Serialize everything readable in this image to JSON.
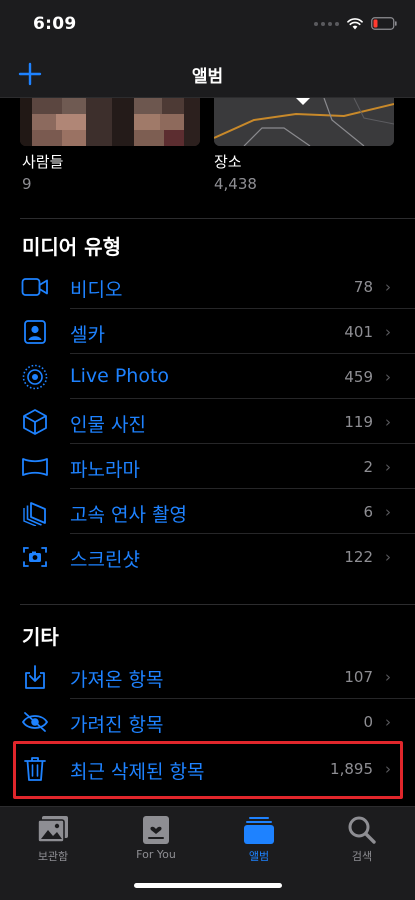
{
  "status_bar": {
    "time": "6:09"
  },
  "nav": {
    "title": "앨범",
    "add_icon": "plus-icon"
  },
  "people": {
    "caption": "사람들",
    "count": "9"
  },
  "places": {
    "caption": "장소",
    "count": "4,438"
  },
  "media_types": {
    "title": "미디어 유형",
    "items": [
      {
        "label": "비디오",
        "count": "78",
        "icon": "video-icon"
      },
      {
        "label": "셀카",
        "count": "401",
        "icon": "selfie-icon"
      },
      {
        "label": "Live Photo",
        "count": "459",
        "icon": "live-photo-icon"
      },
      {
        "label": "인물 사진",
        "count": "119",
        "icon": "portrait-cube-icon"
      },
      {
        "label": "파노라마",
        "count": "2",
        "icon": "panorama-icon"
      },
      {
        "label": "고속 연사 촬영",
        "count": "6",
        "icon": "burst-icon"
      },
      {
        "label": "스크린샷",
        "count": "122",
        "icon": "screenshot-icon"
      }
    ]
  },
  "other": {
    "title": "기타",
    "items": [
      {
        "label": "가져온 항목",
        "count": "107",
        "icon": "import-icon"
      },
      {
        "label": "가려진 항목",
        "count": "0",
        "icon": "hidden-eye-icon"
      },
      {
        "label": "최근 삭제된 항목",
        "count": "1,895",
        "icon": "trash-icon"
      }
    ]
  },
  "tabs": [
    {
      "label": "보관함",
      "icon": "library-icon",
      "active": false
    },
    {
      "label": "For You",
      "icon": "for-you-icon",
      "active": false
    },
    {
      "label": "앨범",
      "icon": "albums-icon",
      "active": true
    },
    {
      "label": "검색",
      "icon": "search-icon",
      "active": false
    }
  ],
  "colors": {
    "accent": "#1e82ff",
    "highlight": "#e0262b",
    "background": "#000000",
    "bar": "#1c1c1e"
  }
}
